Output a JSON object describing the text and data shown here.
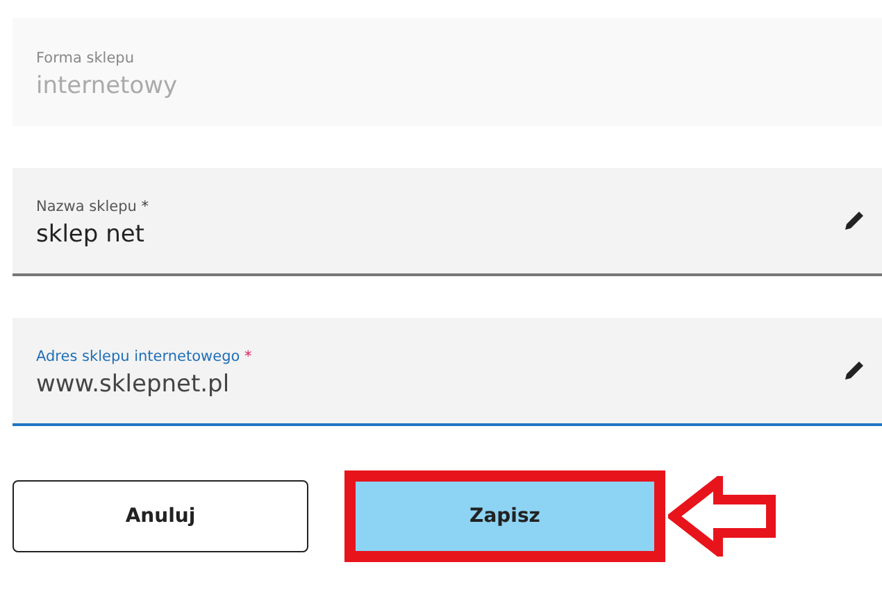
{
  "fields": [
    {
      "label": "Forma sklepu",
      "value": "internetowy",
      "required": false,
      "disabled": true,
      "focused": false,
      "editable": false
    },
    {
      "label": "Nazwa sklepu",
      "value": "sklep net",
      "required": true,
      "disabled": false,
      "focused": false,
      "editable": true
    },
    {
      "label": "Adres sklepu internetowego",
      "value": "www.sklepnet.pl",
      "required": true,
      "disabled": false,
      "focused": true,
      "editable": true
    }
  ],
  "required_mark": "*",
  "buttons": [
    {
      "label": "Anuluj",
      "kind": "secondary",
      "highlighted": false
    },
    {
      "label": "Zapisz",
      "kind": "primary",
      "highlighted": true
    }
  ]
}
